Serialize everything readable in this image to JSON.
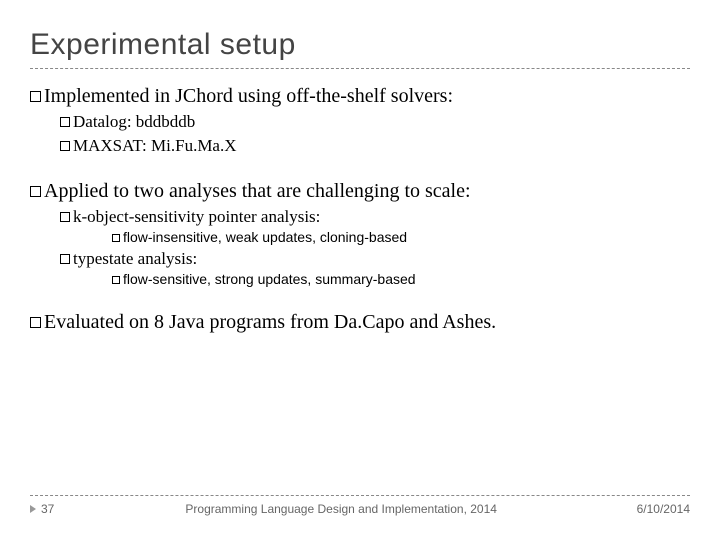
{
  "title": "Experimental setup",
  "bullets": {
    "b1": "Implemented in JChord using off-the-shelf solvers:",
    "b1a": "Datalog: bddbddb",
    "b1b": "MAXSAT: Mi.Fu.Ma.X",
    "b2": "Applied to two analyses that are challenging to scale:",
    "b2a": "k-object-sensitivity pointer analysis:",
    "b2a1": "flow-insensitive, weak updates, cloning-based",
    "b2b": "typestate analysis:",
    "b2b1": "flow-sensitive, strong updates, summary-based",
    "b3": "Evaluated on 8 Java programs from Da.Capo and Ashes."
  },
  "footer": {
    "page": "37",
    "venue": "Programming Language Design and Implementation, 2014",
    "date": "6/10/2014"
  }
}
